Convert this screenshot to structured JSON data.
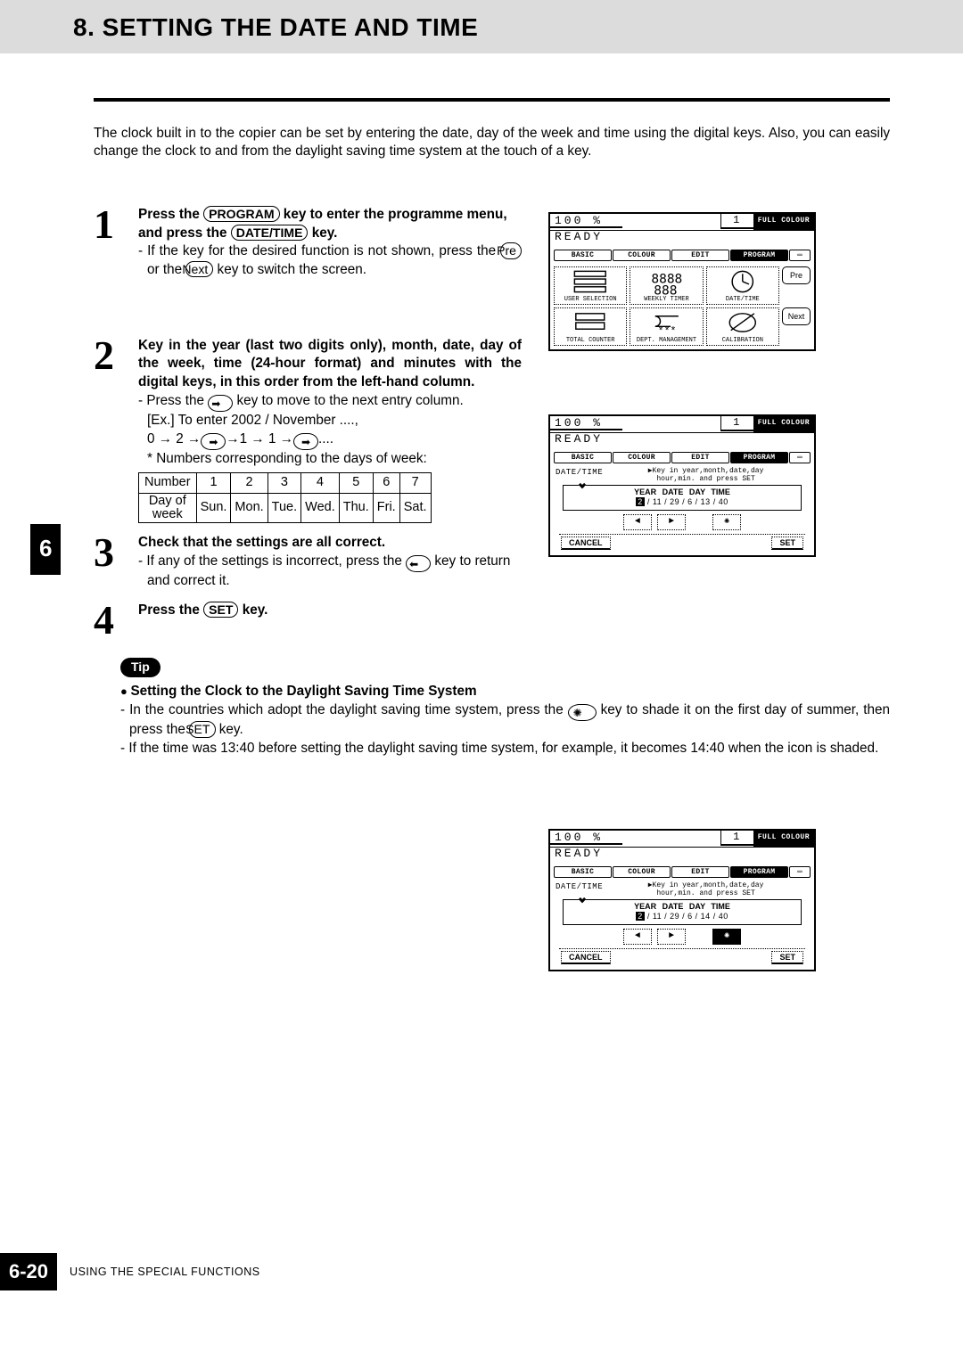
{
  "page": {
    "section_number": "8.",
    "section_title": "SETTING THE DATE AND TIME",
    "chapter_tab": "6",
    "footer_page": "6-20",
    "footer_text": "USING THE SPECIAL FUNCTIONS"
  },
  "intro": "The clock built in to the copier can be set by entering the date, day of the week and time using the digital keys.  Also, you can easily change the clock to and from the daylight saving time system at the touch of a key.",
  "steps": {
    "s1": {
      "head_a": "Press the ",
      "key1": "PROGRAM",
      "head_b": " key to enter the programme menu, and press the ",
      "key2": "DATE/TIME",
      "head_c": " key.",
      "line1a": "If the key for the desired function is not shown, press the ",
      "pre": "Pre",
      "mid": " or the  ",
      "next": "Next",
      "line1b": " key to switch  the screen."
    },
    "s2": {
      "head": "Key in the year (last two digits only), month, date, day of the week, time (24-hour format) and minutes with the digital keys, in this order from the left-hand column.",
      "l1a": "Press the ",
      "l1b": " key to move to the next entry column.",
      "l2": "[Ex.] To enter 2002 / November ....,",
      "l3a": "0 → 2 →",
      "l3b": "→1 → 1 →",
      "l3c": "....",
      "note": "* Numbers corresponding to the days of week:",
      "table": {
        "row1": [
          "Number",
          "1",
          "2",
          "3",
          "4",
          "5",
          "6",
          "7"
        ],
        "row2_label_l1": "Day of",
        "row2_label_l2": "week",
        "row2": [
          "Sun.",
          "Mon.",
          "Tue.",
          "Wed.",
          "Thu.",
          "Fri.",
          "Sat."
        ]
      }
    },
    "s3": {
      "head": "Check that the settings are all correct.",
      "l1a": "If any of the settings is incorrect, press the ",
      "l1b": " key to return and correct it."
    },
    "s4": {
      "head_a": "Press the ",
      "key": "SET",
      "head_b": " key."
    }
  },
  "tip": {
    "badge": "Tip",
    "title": "Setting the Clock to the Daylight Saving Time System",
    "l1a": "In the countries which adopt the daylight saving time system, press the ",
    "l1b": " key to shade it on the first day of summer, then press the ",
    "setkey": "SET",
    "l1c": " key.",
    "l2": "If the time was 13:40 before setting the daylight saving time system, for example, it becomes 14:40 when the icon is shaded."
  },
  "lcd_common": {
    "zoom": "100",
    "pct": "%",
    "jobs": "1",
    "mode": "FULL COLOUR",
    "ready": "READY",
    "tabs": [
      "BASIC",
      "COLOUR",
      "EDIT",
      "PROGRAM"
    ],
    "pre": "Pre",
    "next": "Next"
  },
  "lcd1": {
    "cells": [
      "USER SELECTION",
      "WEEKLY TIMER",
      "DATE/TIME",
      "TOTAL COUNTER",
      "DEPT. MANAGEMENT",
      "CALIBRATION"
    ]
  },
  "lcd_dt": {
    "label": "DATE/TIME",
    "hint_l1": "▶Key in year,month,date,day",
    "hint_l2": "hour,min. and press SET",
    "cols": "YEAR   DATE   DAY   TIME",
    "vals1_year": "2",
    "vals1_rest": " / 11  / 29  / 6   / 13 / 40",
    "vals2_year": "2",
    "vals2_rest": " / 11  / 29  / 6   / 14 / 40",
    "cancel": "CANCEL",
    "set": "SET"
  }
}
